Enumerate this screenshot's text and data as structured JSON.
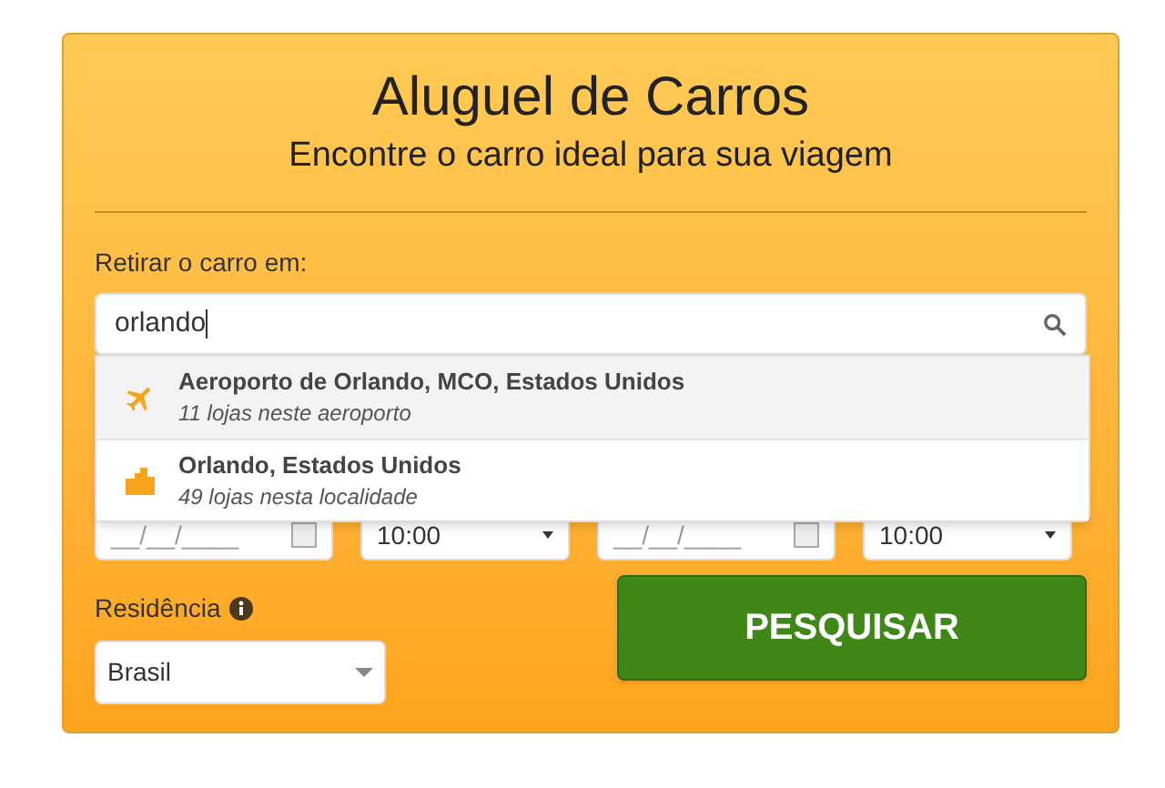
{
  "header": {
    "title": "Aluguel de Carros",
    "subtitle": "Encontre o carro ideal para sua viagem"
  },
  "pickup": {
    "label": "Retirar o carro em:",
    "value": "orlando"
  },
  "suggestions": [
    {
      "kind": "airport",
      "name": "Aeroporto de Orlando, MCO, Estados Unidos",
      "detail": "11 lojas neste aeroporto",
      "selected": true
    },
    {
      "kind": "city",
      "name": "Orlando, Estados Unidos",
      "detail": "49 lojas nesta localidade",
      "selected": false
    }
  ],
  "schedule": [
    {
      "kind": "date",
      "placeholder": "__/__/____"
    },
    {
      "kind": "time",
      "value": "10:00"
    },
    {
      "kind": "date",
      "placeholder": "__/__/____"
    },
    {
      "kind": "time",
      "value": "10:00"
    }
  ],
  "residence": {
    "label": "Residência",
    "value": "Brasil"
  },
  "search_button": "PESQUISAR"
}
